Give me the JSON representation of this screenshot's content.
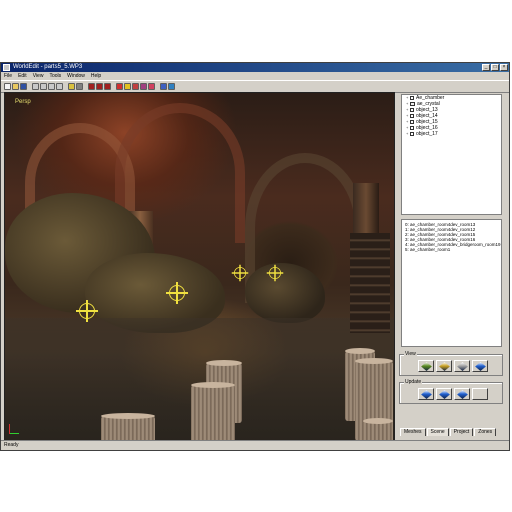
{
  "window": {
    "title": "WorldEdit - parts5_5.WP3"
  },
  "menubar": {
    "items": [
      "File",
      "Edit",
      "View",
      "Tools",
      "Window",
      "Help"
    ]
  },
  "toolbar": {
    "buttons": [
      {
        "icon": "new-icon",
        "color": "#f4f4f4"
      },
      {
        "icon": "open-icon",
        "color": "#e8c860"
      },
      {
        "icon": "save-icon",
        "color": "#3050a0"
      },
      {
        "icon": "gap"
      },
      {
        "icon": "pointer-icon",
        "color": "#c8c8c8"
      },
      {
        "icon": "select-icon",
        "color": "#c8c8c8"
      },
      {
        "icon": "move-icon",
        "color": "#c8c8c8"
      },
      {
        "icon": "rotate-icon",
        "color": "#c8c8c8"
      },
      {
        "icon": "gap"
      },
      {
        "icon": "light-icon",
        "color": "#d8c040"
      },
      {
        "icon": "camera-icon",
        "color": "#808080"
      },
      {
        "icon": "gap"
      },
      {
        "icon": "arrow-left-icon",
        "color": "#a02020"
      },
      {
        "icon": "arrow-right-icon",
        "color": "#a02020"
      },
      {
        "icon": "arrow-up-icon",
        "color": "#a02020"
      },
      {
        "icon": "gap"
      },
      {
        "icon": "sphere-icon",
        "color": "#d03030"
      },
      {
        "icon": "circle-icon",
        "color": "#e0c020"
      },
      {
        "icon": "target-icon",
        "color": "#c04040"
      },
      {
        "icon": "paint-icon",
        "color": "#a04080"
      },
      {
        "icon": "tag-icon",
        "color": "#d04060"
      },
      {
        "icon": "gap"
      },
      {
        "icon": "grid-icon",
        "color": "#4060c0"
      },
      {
        "icon": "palette-icon",
        "color": "#3080c0"
      }
    ]
  },
  "viewport": {
    "label": "Persp"
  },
  "tree": {
    "items": [
      {
        "label": "Ae_chamber",
        "kind": "check"
      },
      {
        "label": "ae_crystal",
        "kind": "object"
      },
      {
        "label": "object_13",
        "kind": "check"
      },
      {
        "label": "object_14",
        "kind": "check"
      },
      {
        "label": "object_15",
        "kind": "check"
      },
      {
        "label": "object_16",
        "kind": "check"
      },
      {
        "label": "object_17",
        "kind": "check"
      }
    ]
  },
  "list": {
    "items": [
      "0: ae_chamber_room4dev_room13",
      "1: ae_chamber_room4dev_room12",
      "2: ae_chamber_room4dev_room15",
      "3: ae_chamber_room4dev_room16",
      "4: ae_chamber_room4dev_bridgeroom_room19",
      "5: ae_chamber_room1"
    ]
  },
  "view_group": {
    "label": "View",
    "buttons": [
      {
        "icon": "view-cube-solid-icon",
        "color": "#5a8a20"
      },
      {
        "icon": "view-cube-textured-icon",
        "color": "#c8a020"
      },
      {
        "icon": "view-cube-wire-icon",
        "color": "#a0a0a0"
      },
      {
        "icon": "view-cube-blue-icon",
        "color": "#2060d0"
      }
    ]
  },
  "update_group": {
    "label": "Update",
    "buttons": [
      {
        "icon": "update-cube-icon",
        "color": "#2060d0"
      },
      {
        "icon": "update-cube-all-icon",
        "color": "#2060d0"
      },
      {
        "icon": "update-cube-selected-icon",
        "color": "#2060d0"
      },
      {
        "icon": "blank",
        "color": "#d4d0c8"
      }
    ]
  },
  "tabs": [
    "Meshes",
    "Scene",
    "Project",
    "Zones"
  ],
  "statusbar": {
    "text": "Ready"
  }
}
